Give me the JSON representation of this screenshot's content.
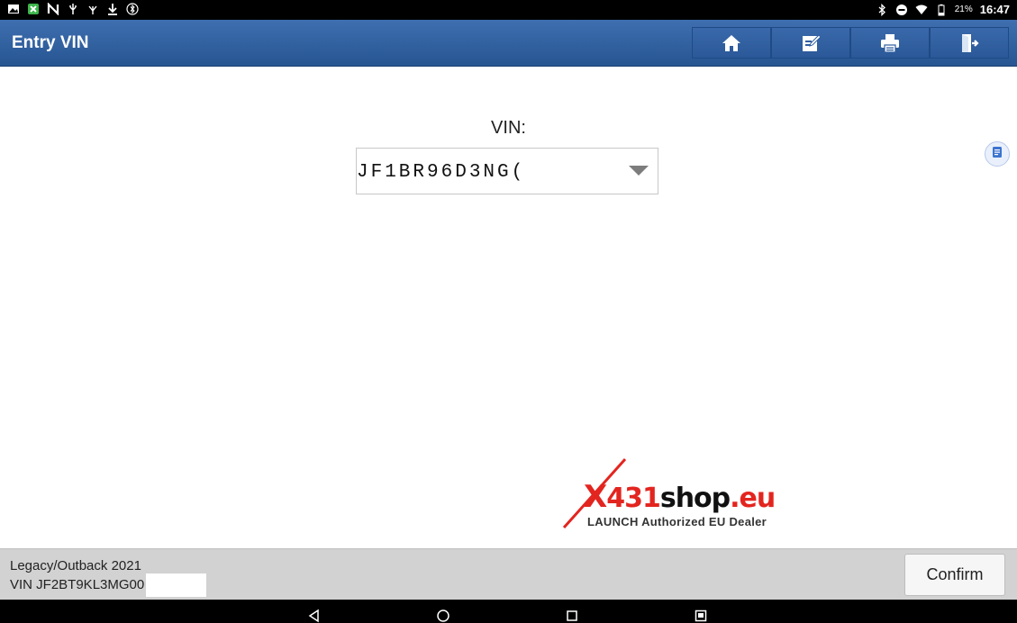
{
  "status_bar": {
    "battery": "21%",
    "time": "16:47",
    "left_icons": [
      "image-icon",
      "app-icon",
      "n-icon",
      "usb-icon",
      "usb-debug-icon",
      "download-icon",
      "bluetooth-settings-icon"
    ],
    "right_icons": [
      "bluetooth-icon",
      "dnd-icon",
      "wifi-icon",
      "battery-icon"
    ]
  },
  "header": {
    "title": "Entry VIN",
    "buttons": [
      "home-icon",
      "edit-icon",
      "print-icon",
      "exit-icon"
    ]
  },
  "main": {
    "vin_label": "VIN:",
    "vin_value": "JF1BR96D3NG("
  },
  "watermark": {
    "x": "X",
    "digits": "431",
    "shop": "shop",
    "suffix": ".eu",
    "tagline": "LAUNCH Authorized EU Dealer"
  },
  "footer": {
    "model": "Legacy/Outback 2021",
    "vin": "VIN JF2BT9KL3MG00",
    "confirm_label": "Confirm"
  },
  "colors": {
    "header_blue": "#2f5e9f",
    "brand_red": "#e3251f"
  }
}
